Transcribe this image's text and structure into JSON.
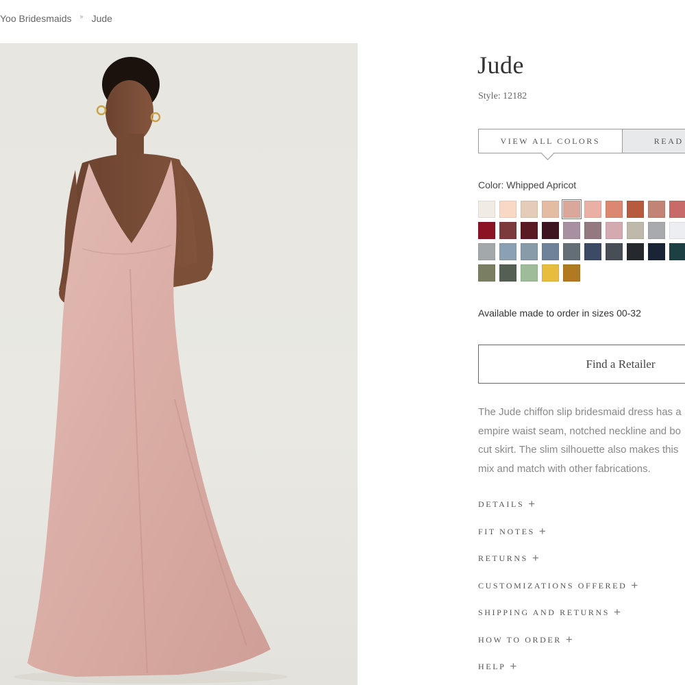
{
  "breadcrumb": {
    "items": [
      "Yoo Bridesmaids",
      "Jude"
    ],
    "separator": "»"
  },
  "product": {
    "title": "Jude",
    "style_line": "Style: 12182",
    "tabs": {
      "view_all_colors": "VIEW ALL COLORS",
      "second_tab": "READ"
    },
    "color_label": "Color: Whipped Apricot",
    "availability": "Available made to order in sizes 00-32",
    "find_retailer": "Find a Retailer",
    "description_lines": [
      "The Jude chiffon slip bridesmaid dress has a",
      "empire waist seam, notched neckline and bo",
      "cut skirt. The slim silhouette also makes this",
      "mix and match with other fabrications."
    ]
  },
  "swatch_colors": [
    "#f1ece3",
    "#f9d9c6",
    "#e3cdb8",
    "#e4bca4",
    "#d9a89a",
    "#eab0a5",
    "#dc8771",
    "#b85a3e",
    "#c28474",
    "#c96a6a",
    "#8a1423",
    "#7d3a3c",
    "#5a1a24",
    "#3d1420",
    "#a890a0",
    "#947a80",
    "#d5a9b0",
    "#bfb9ab",
    "#a9aaad",
    "#eceef2",
    "#a3a9ab",
    "#8ba1b3",
    "#889ba8",
    "#6e8299",
    "#636e76",
    "#3d4a66",
    "#474e56",
    "#25292d",
    "#1b2436",
    "#1d4044",
    "#7b7f62",
    "#555f54",
    "#9fbc9a",
    "#e8bd3e",
    "#b17a22"
  ],
  "selected_swatch_index": 4,
  "accordion": [
    {
      "label": "DETAILS",
      "symbol": "+"
    },
    {
      "label": "FIT NOTES",
      "symbol": "+"
    },
    {
      "label": "RETURNS",
      "symbol": "+"
    },
    {
      "label": "CUSTOMIZATIONS OFFERED",
      "symbol": "+"
    },
    {
      "label": "SHIPPING AND RETURNS",
      "symbol": "+"
    },
    {
      "label": "HOW TO ORDER",
      "symbol": "+"
    },
    {
      "label": "HELP",
      "symbol": "+"
    }
  ],
  "icons": {
    "accordion_expand": "plus-icon",
    "breadcrumb_separator": "double-chevron-right-icon"
  }
}
